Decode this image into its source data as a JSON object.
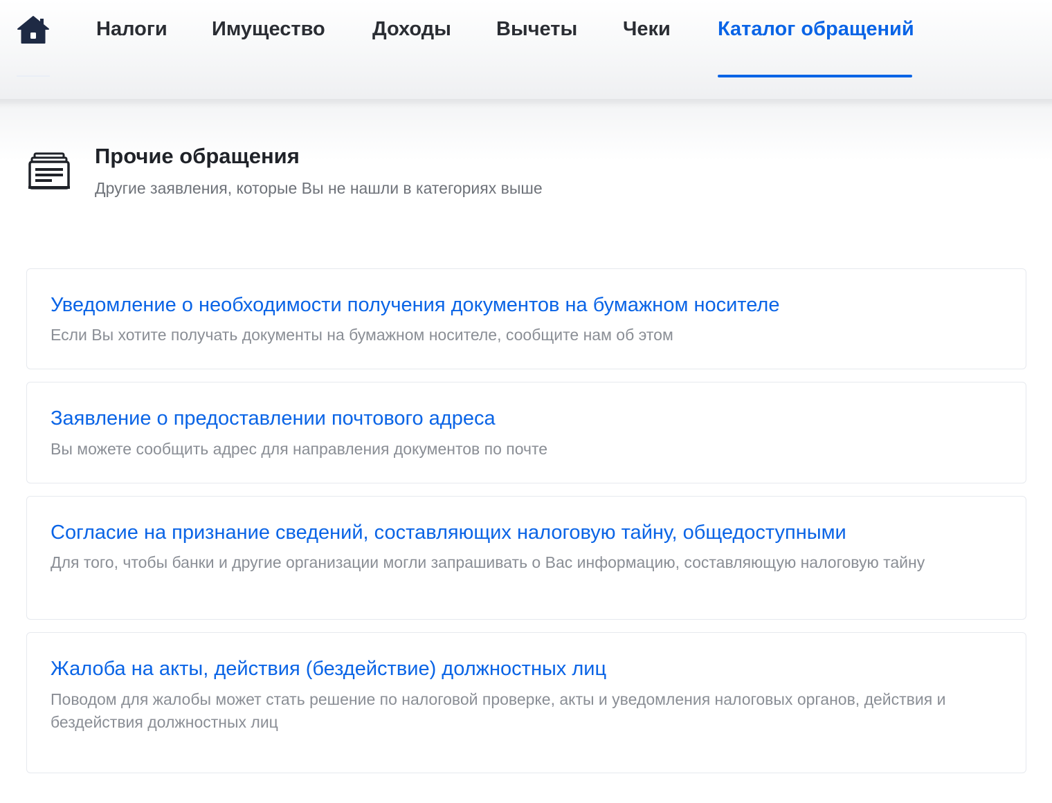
{
  "nav": {
    "home_icon": "home-icon",
    "items": [
      {
        "label": "Налоги",
        "active": false
      },
      {
        "label": "Имущество",
        "active": false
      },
      {
        "label": "Доходы",
        "active": false
      },
      {
        "label": "Вычеты",
        "active": false
      },
      {
        "label": "Чеки",
        "active": false
      },
      {
        "label": "Каталог обращений",
        "active": true
      }
    ]
  },
  "section": {
    "icon": "document-stack-icon",
    "title": "Прочие обращения",
    "subtitle": "Другие заявления, которые Вы не нашли в категориях выше"
  },
  "cards": [
    {
      "title": "Уведомление о необходимости получения документов на бумажном носителе",
      "description": "Если Вы хотите получать документы на бумажном носителе, сообщите нам об этом"
    },
    {
      "title": "Заявление о предоставлении почтового адреса",
      "description": "Вы можете сообщить адрес для направления документов по почте"
    },
    {
      "title": "Согласие на признание сведений, составляющих налоговую тайну, общедоступными",
      "description": "Для того, чтобы банки и другие организации могли запрашивать о Вас информацию, составляющую налоговую тайну"
    },
    {
      "title": "Жалоба на акты, действия (бездействие) должностных лиц",
      "description": "Поводом для жалобы может стать решение по налоговой проверке, акты и уведомления налоговых органов, действия и бездействия должностных лиц"
    }
  ],
  "colors": {
    "accent": "#0a64e6",
    "nav_text": "#2a2d33",
    "muted_text": "#8a8e95",
    "card_border": "#e6e9ee"
  }
}
